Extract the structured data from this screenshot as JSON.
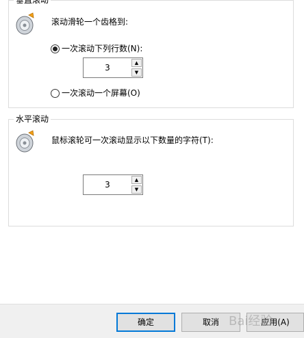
{
  "vertical": {
    "title": "垂直滚动",
    "heading": "滚动滑轮一个齿格到:",
    "option_lines": "一次滚动下列行数(N):",
    "lines_value": "3",
    "option_screen": "一次滚动一个屏幕(O)"
  },
  "horizontal": {
    "title": "水平滚动",
    "heading": "鼠标滚轮可一次滚动显示以下数量的字符(T):",
    "chars_value": "3"
  },
  "buttons": {
    "ok": "确定",
    "cancel": "取消",
    "apply": "应用(A)"
  },
  "watermark": "Bai经验"
}
